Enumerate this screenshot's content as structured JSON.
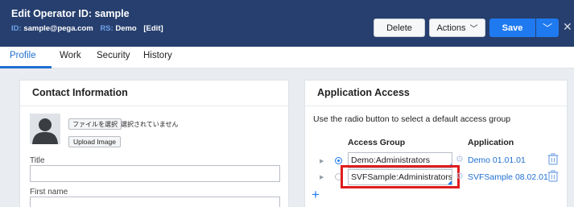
{
  "header": {
    "title": "Edit  Operator ID: sample",
    "id_label": "ID:",
    "id_value": "sample@pega.com",
    "rs_label": "RS:",
    "rs_value": "Demo",
    "edit_link": "[Edit]",
    "bg_color": "#263f6e"
  },
  "toolbar": {
    "delete_label": "Delete",
    "actions_label": "Actions",
    "save_label": "Save",
    "close_icon": "close-icon",
    "save_color": "#1f7af0"
  },
  "tabs": [
    {
      "label": "Profile",
      "active": true
    },
    {
      "label": "Work",
      "active": false
    },
    {
      "label": "Security",
      "active": false
    },
    {
      "label": "History",
      "active": false
    }
  ],
  "contact": {
    "title": "Contact Information",
    "file_button": "ファイルを選択",
    "file_status": "選択されていません",
    "upload_button": "Upload Image",
    "fields": [
      {
        "label": "Title",
        "value": ""
      },
      {
        "label": "First name",
        "value": ""
      }
    ]
  },
  "access": {
    "title": "Application Access",
    "description": "Use the radio button to select a default access group",
    "col_access_group": "Access Group",
    "col_application": "Application",
    "rows": [
      {
        "access_group": "Demo:Administrators",
        "application": "Demo  01.01.01",
        "selected": true
      },
      {
        "access_group": "SVFSample:Administrators",
        "application": "SVFSample  08.02.01",
        "selected": false
      }
    ],
    "highlight_color": "#e01d1d"
  }
}
